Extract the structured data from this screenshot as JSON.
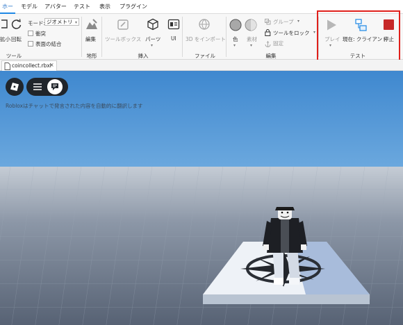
{
  "menu": {
    "tabs": [
      {
        "label": "ホーム"
      },
      {
        "label": "モデル"
      },
      {
        "label": "アバター"
      },
      {
        "label": "テスト"
      },
      {
        "label": "表示"
      },
      {
        "label": "プラグイン"
      }
    ]
  },
  "ribbon": {
    "tools": {
      "scale_label": "拡小",
      "rotate_label": "回転",
      "mode_label": "モード:",
      "mode_value": "ジオメトリ",
      "collision_label": "衝突",
      "join_surfaces_label": "表面の結合",
      "group_label": "ツール"
    },
    "terrain": {
      "edit_label": "編集",
      "group_label": "地形"
    },
    "insert": {
      "toolbox_label": "ツールボックス",
      "parts_label": "パーツ",
      "ui_label": "UI",
      "group_label": "挿入"
    },
    "file": {
      "import3d_label": "3D をインポート",
      "group_label": "ファイル"
    },
    "edit": {
      "color_label": "色",
      "material_label": "素材",
      "group_label_btn": "グループ",
      "lock_label": "ツールをロック",
      "anchor_label": "固定",
      "group_label": "編集"
    },
    "test": {
      "play_label": "プレイ",
      "current_client_label": "現在: クライアント",
      "stop_label": "停止",
      "group_label": "テスト"
    }
  },
  "file_tab": {
    "name": "coincollect.rbxl",
    "close": "×"
  },
  "viewport": {
    "chat_message": "Robloxはチャットで発言された内容を自動的に翻訳します"
  },
  "colors": {
    "accent": "#1e88e5",
    "highlight": "#e0201b",
    "stop_red": "#c62828"
  }
}
